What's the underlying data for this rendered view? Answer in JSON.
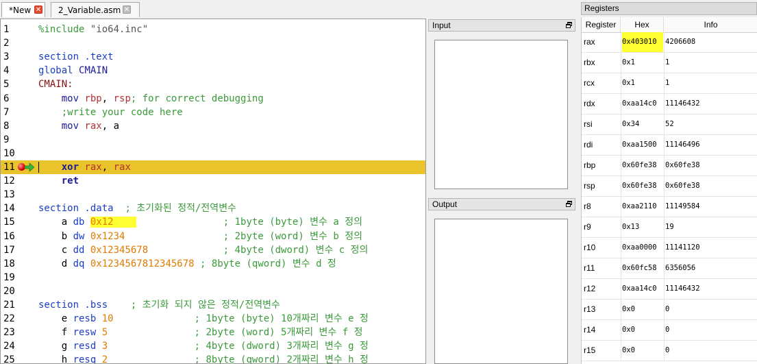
{
  "tabs": [
    {
      "label": "*New",
      "active": true
    },
    {
      "label": "2_Variable.asm",
      "active": false
    }
  ],
  "editor": {
    "lines": [
      {
        "n": "1",
        "tokens": [
          {
            "t": "%include ",
            "c": "directive"
          },
          {
            "t": "\"io64.inc\"",
            "c": "string"
          }
        ]
      },
      {
        "n": "2",
        "tokens": []
      },
      {
        "n": "3",
        "tokens": [
          {
            "t": "section .text",
            "c": "keyword"
          }
        ]
      },
      {
        "n": "4",
        "tokens": [
          {
            "t": "global ",
            "c": "keyword"
          },
          {
            "t": "CMAIN",
            "c": "instr"
          }
        ]
      },
      {
        "n": "5",
        "tokens": [
          {
            "t": "CMAIN:",
            "c": "label"
          }
        ]
      },
      {
        "n": "6",
        "tokens": [
          {
            "t": "    ",
            "c": "ident"
          },
          {
            "t": "mov ",
            "c": "instr"
          },
          {
            "t": "rbp",
            "c": "reg"
          },
          {
            "t": ", ",
            "c": "ident"
          },
          {
            "t": "rsp",
            "c": "reg"
          },
          {
            "t": "; for correct debugging",
            "c": "comment"
          }
        ]
      },
      {
        "n": "7",
        "tokens": [
          {
            "t": "    ;write your code here",
            "c": "comment"
          }
        ]
      },
      {
        "n": "8",
        "tokens": [
          {
            "t": "    ",
            "c": "ident"
          },
          {
            "t": "mov ",
            "c": "instr"
          },
          {
            "t": "rax",
            "c": "reg"
          },
          {
            "t": ", a",
            "c": "ident"
          }
        ]
      },
      {
        "n": "9",
        "tokens": []
      },
      {
        "n": "10",
        "tokens": []
      },
      {
        "n": "11",
        "tokens": [
          {
            "t": "    ",
            "c": "ident"
          },
          {
            "t": "xor ",
            "c": "instr bold"
          },
          {
            "t": "rax",
            "c": "reg"
          },
          {
            "t": ", ",
            "c": "ident"
          },
          {
            "t": "rax",
            "c": "reg"
          }
        ],
        "highlight": true,
        "breakpoint": true
      },
      {
        "n": "12",
        "tokens": [
          {
            "t": "    ",
            "c": "ident"
          },
          {
            "t": "ret",
            "c": "instr bold"
          }
        ]
      },
      {
        "n": "13",
        "tokens": []
      },
      {
        "n": "14",
        "tokens": [
          {
            "t": "section .data  ",
            "c": "keyword"
          },
          {
            "t": "; 초기화된 정적/전역변수",
            "c": "comment"
          }
        ]
      },
      {
        "n": "15",
        "tokens": [
          {
            "t": "    a ",
            "c": "ident"
          },
          {
            "t": "db ",
            "c": "keyword"
          },
          {
            "t": "0x12    ",
            "c": "number sel"
          },
          {
            "t": "               ",
            "c": "ident"
          },
          {
            "t": "; 1byte (byte) 변수 a 정의",
            "c": "comment"
          }
        ]
      },
      {
        "n": "16",
        "tokens": [
          {
            "t": "    b ",
            "c": "ident"
          },
          {
            "t": "dw ",
            "c": "keyword"
          },
          {
            "t": "0x1234",
            "c": "number"
          },
          {
            "t": "                 ",
            "c": "ident"
          },
          {
            "t": "; 2byte (word) 변수 b 정의",
            "c": "comment"
          }
        ]
      },
      {
        "n": "17",
        "tokens": [
          {
            "t": "    c ",
            "c": "ident"
          },
          {
            "t": "dd ",
            "c": "keyword"
          },
          {
            "t": "0x12345678",
            "c": "number"
          },
          {
            "t": "             ",
            "c": "ident"
          },
          {
            "t": "; 4byte (dword) 변수 c 정의",
            "c": "comment"
          }
        ]
      },
      {
        "n": "18",
        "tokens": [
          {
            "t": "    d ",
            "c": "ident"
          },
          {
            "t": "dq ",
            "c": "keyword"
          },
          {
            "t": "0x1234567812345678",
            "c": "number"
          },
          {
            "t": " ",
            "c": "ident"
          },
          {
            "t": "; 8byte (qword) 변수 d 정",
            "c": "comment"
          }
        ]
      },
      {
        "n": "19",
        "tokens": []
      },
      {
        "n": "20",
        "tokens": []
      },
      {
        "n": "21",
        "tokens": [
          {
            "t": "section .bss    ",
            "c": "keyword"
          },
          {
            "t": "; 초기화 되지 않은 정적/전역변수",
            "c": "comment"
          }
        ]
      },
      {
        "n": "22",
        "tokens": [
          {
            "t": "    e ",
            "c": "ident"
          },
          {
            "t": "resb ",
            "c": "keyword"
          },
          {
            "t": "10",
            "c": "number"
          },
          {
            "t": "              ",
            "c": "ident"
          },
          {
            "t": "; 1byte (byte) 10개짜리 변수 e 정",
            "c": "comment"
          }
        ]
      },
      {
        "n": "23",
        "tokens": [
          {
            "t": "    f ",
            "c": "ident"
          },
          {
            "t": "resw ",
            "c": "keyword"
          },
          {
            "t": "5",
            "c": "number"
          },
          {
            "t": "               ",
            "c": "ident"
          },
          {
            "t": "; 2byte (word) 5개짜리 변수 f 정",
            "c": "comment"
          }
        ]
      },
      {
        "n": "24",
        "tokens": [
          {
            "t": "    g ",
            "c": "ident"
          },
          {
            "t": "resd ",
            "c": "keyword"
          },
          {
            "t": "3",
            "c": "number"
          },
          {
            "t": "               ",
            "c": "ident"
          },
          {
            "t": "; 4byte (dword) 3개짜리 변수 g 정",
            "c": "comment"
          }
        ]
      },
      {
        "n": "25",
        "tokens": [
          {
            "t": "    h ",
            "c": "ident"
          },
          {
            "t": "resq ",
            "c": "keyword"
          },
          {
            "t": "2",
            "c": "number"
          },
          {
            "t": "               ",
            "c": "ident"
          },
          {
            "t": "; 8byte (qword) 2개짜리 변수 h 정",
            "c": "comment"
          }
        ]
      },
      {
        "n": "26",
        "tokens": []
      }
    ]
  },
  "panels": {
    "input_title": "Input",
    "output_title": "Output"
  },
  "registers": {
    "title": "Registers",
    "columns": [
      "Register",
      "Hex",
      "Info"
    ],
    "rows": [
      {
        "name": "rax",
        "hex": "0x403010",
        "info": "4206608",
        "highlight": true
      },
      {
        "name": "rbx",
        "hex": "0x1",
        "info": "1"
      },
      {
        "name": "rcx",
        "hex": "0x1",
        "info": "1"
      },
      {
        "name": "rdx",
        "hex": "0xaa14c0",
        "info": "11146432"
      },
      {
        "name": "rsi",
        "hex": "0x34",
        "info": "52"
      },
      {
        "name": "rdi",
        "hex": "0xaa1500",
        "info": "11146496"
      },
      {
        "name": "rbp",
        "hex": "0x60fe38",
        "info": "0x60fe38"
      },
      {
        "name": "rsp",
        "hex": "0x60fe38",
        "info": "0x60fe38"
      },
      {
        "name": "r8",
        "hex": "0xaa2110",
        "info": "11149584"
      },
      {
        "name": "r9",
        "hex": "0x13",
        "info": "19"
      },
      {
        "name": "r10",
        "hex": "0xaa0000",
        "info": "11141120"
      },
      {
        "name": "r11",
        "hex": "0x60fc58",
        "info": "6356056"
      },
      {
        "name": "r12",
        "hex": "0xaa14c0",
        "info": "11146432"
      },
      {
        "name": "r13",
        "hex": "0x0",
        "info": "0"
      },
      {
        "name": "r14",
        "hex": "0x0",
        "info": "0"
      },
      {
        "name": "r15",
        "hex": "0x0",
        "info": "0"
      }
    ]
  },
  "icons": {
    "tab_close": "close-icon",
    "panel_float": "float-window-icon",
    "breakpoint": "breakpoint-icon",
    "exec_arrow": "execution-arrow-icon"
  },
  "colors": {
    "highlight_line": "#e9c32c",
    "selection": "#ffff33",
    "keyword": "#1a3cc8",
    "comment": "#3a9a3a",
    "number": "#e07a00",
    "register": "#b23232"
  }
}
